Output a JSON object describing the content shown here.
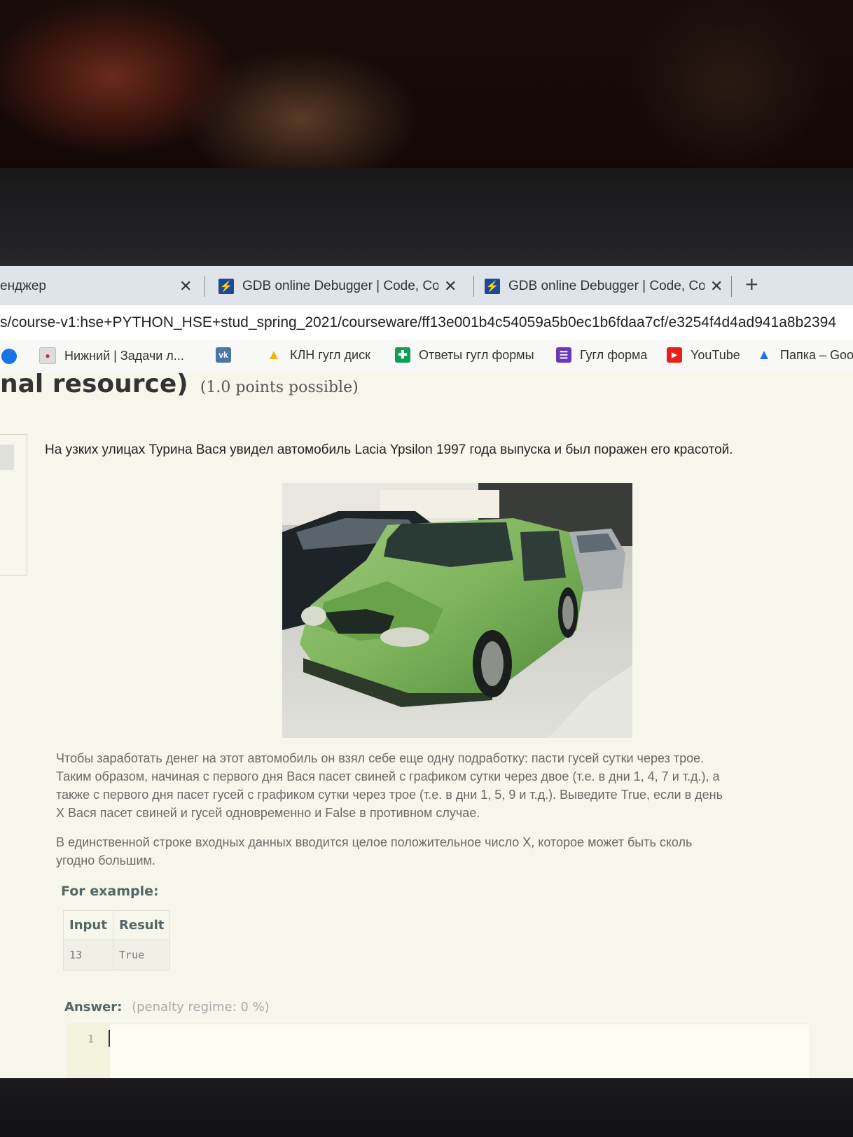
{
  "browser": {
    "tabs": [
      {
        "label": "енджер",
        "close": "✕"
      },
      {
        "label": "GDB online Debugger | Code, Co",
        "close": "✕"
      },
      {
        "label": "GDB online Debugger | Code, Co",
        "close": "✕"
      }
    ],
    "new_tab": "+",
    "url": "s/course-v1:hse+PYTHON_HSE+stud_spring_2021/courseware/ff13e001b4c54059a5b0ec1b6fdaa7cf/e3254f4d4ad941a8b2394",
    "bookmarks": [
      {
        "label": "Нижний | Задачи л...",
        "icon": "nizhny-icon"
      },
      {
        "label": "",
        "icon": "vk-icon"
      },
      {
        "label": "КЛН гугл диск",
        "icon": "google-drive-icon"
      },
      {
        "label": "Ответы гугл формы",
        "icon": "google-sheets-icon"
      },
      {
        "label": "Гугл форма",
        "icon": "google-forms-icon"
      },
      {
        "label": "YouTube",
        "icon": "youtube-icon"
      },
      {
        "label": "Папка – Goog",
        "icon": "google-drive-icon"
      }
    ]
  },
  "problem": {
    "title": "nal resource)",
    "points": "(1.0 points possible)",
    "intro": "На узких улицах Турина Вася увидел автомобиль Lacia Ypsilon 1997 года выпуска и был поражен его красотой.",
    "paragraph1_lines": [
      "Чтобы заработать денег на этот автомобиль он взял себе еще одну подработку: пасти гусей сутки через трое.",
      "Таким образом, начиная с первого дня Вася пасет свиней с графиком сутки через двое (т.е. в дни 1, 4, 7 и т.д.), а",
      "также с первого дня пасет гусей с графиком сутки через трое (т.е. в дни 1, 5, 9 и т.д.). Выведите True, если в день",
      "X Вася пасет свиней и гусей одновременно и False в противном случае."
    ],
    "paragraph2_lines": [
      "В единственной строке входных данных вводится целое положительное число X, которое может быть сколь",
      "угодно большим."
    ],
    "example_label": "For example:",
    "example_table": {
      "headers": [
        "Input",
        "Result"
      ],
      "rows": [
        [
          "13",
          "True"
        ]
      ]
    },
    "answer_label": "Answer:",
    "penalty": "(penalty regime: 0 %)",
    "editor_line": "1"
  },
  "colors": {
    "page_bg": "#f7f6ea",
    "tabbar_bg": "#dfe3ea",
    "car_green": "#7fb45c"
  }
}
